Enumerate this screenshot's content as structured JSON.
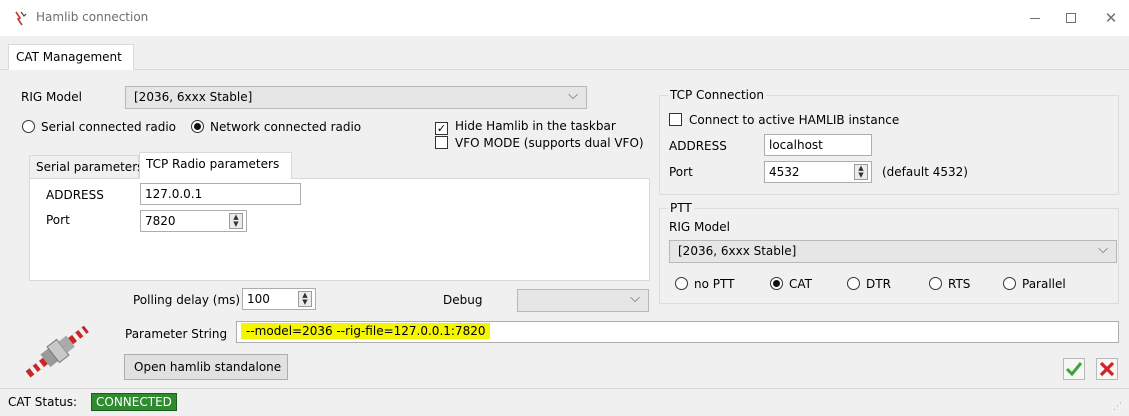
{
  "window": {
    "title": "Hamlib connection"
  },
  "tabs": {
    "active_label": "CAT Management"
  },
  "rig": {
    "model_label": "RIG Model",
    "model_value": "[2036, 6xxx Stable]",
    "radio_serial": "Serial connected radio",
    "radio_network": "Network connected radio",
    "selected_connection": "network"
  },
  "options": {
    "hide_hamlib": "Hide Hamlib in the taskbar",
    "hide_hamlib_checked": true,
    "vfo_mode": "VFO MODE (supports dual VFO)",
    "vfo_mode_checked": false
  },
  "subtabs": {
    "serial": "Serial parameters",
    "tcp": "TCP Radio parameters"
  },
  "tcp_radio": {
    "address_label": "ADDRESS",
    "address_value": "127.0.0.1",
    "port_label": "Port",
    "port_value": "7820"
  },
  "polling": {
    "label": "Polling delay (ms)",
    "value": "100"
  },
  "debug": {
    "label": "Debug",
    "value": ""
  },
  "tcp_connection": {
    "group_title": "TCP Connection",
    "connect_label": "Connect to active HAMLIB instance",
    "connect_checked": false,
    "address_label": "ADDRESS",
    "address_value": "localhost",
    "port_label": "Port",
    "port_value": "4532",
    "port_default": "(default 4532)"
  },
  "ptt": {
    "group_title": "PTT",
    "model_label": "RIG Model",
    "model_value": "[2036, 6xxx Stable]",
    "options": [
      "no PTT",
      "CAT",
      "DTR",
      "RTS",
      "Parallel"
    ],
    "selected": "CAT"
  },
  "parameter": {
    "label": "Parameter String",
    "value": "--model=2036 --rig-file=127.0.0.1:7820"
  },
  "buttons": {
    "open_standalone": "Open hamlib standalone"
  },
  "status": {
    "label": "CAT Status:",
    "value": "CONNECTED"
  },
  "colors": {
    "status_ok": "#2e8b2e",
    "highlight": "#f5f500",
    "accept": "#3aa53a",
    "cancel": "#d42020"
  },
  "icons": {
    "app": "hamlib-app-icon",
    "antenna": "antenna-connector-icon",
    "accept": "green-check-icon",
    "cancel": "red-x-icon"
  }
}
